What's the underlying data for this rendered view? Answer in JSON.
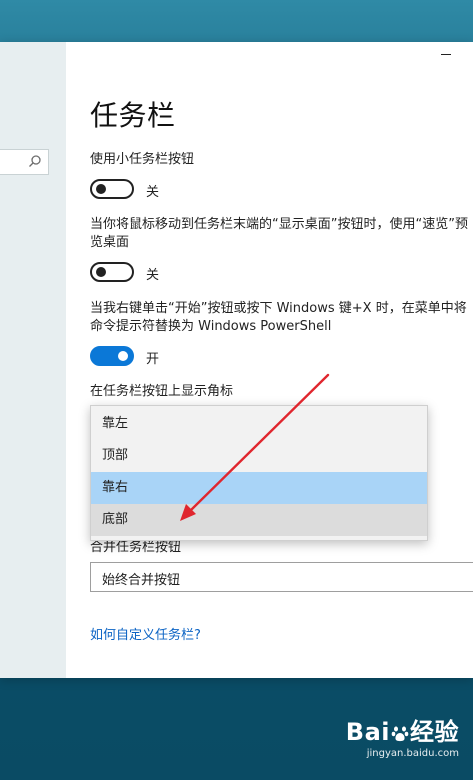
{
  "page": {
    "title": "任务栏"
  },
  "settings": {
    "small_buttons": {
      "label": "使用小任务栏按钮",
      "state": "关"
    },
    "peek": {
      "label": "当你将鼠标移动到任务栏末端的“显示桌面”按钮时，使用“速览”预览桌面",
      "state": "关"
    },
    "powershell": {
      "label": "当我右键单击“开始”按钮或按下 Windows 键+X 时，在菜单中将命令提示符替换为 Windows PowerShell",
      "state": "开"
    },
    "badges": {
      "label": "在任务栏按钮上显示角标"
    },
    "location": {
      "options": [
        "靠左",
        "顶部",
        "靠右",
        "底部"
      ],
      "selected": "靠右",
      "hovered": "底部"
    },
    "combine": {
      "label": "合并任务栏按钮",
      "value": "始终合并按钮"
    }
  },
  "links": {
    "help": "如何自定义任务栏?"
  },
  "watermark": {
    "brand": "Bai du 经验",
    "sub": "jingyan.baidu.com"
  },
  "colors": {
    "accent": "#0b78d7",
    "selected_item": "#a9d4f7",
    "link": "#0b63c4",
    "arrow": "#e0262e"
  },
  "icons": {
    "search": "search-icon",
    "minimize": "minimize-icon"
  }
}
